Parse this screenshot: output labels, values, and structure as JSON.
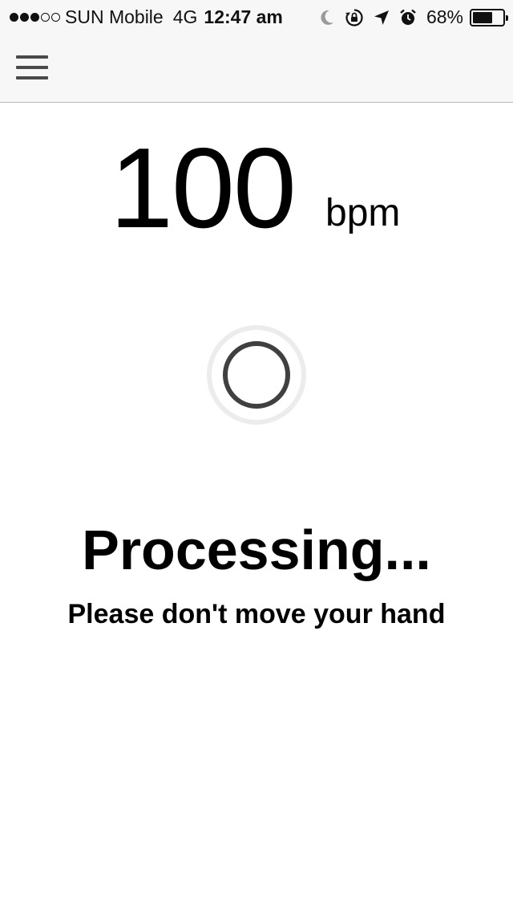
{
  "status_bar": {
    "signal_bars_filled": 3,
    "signal_bars_total": 5,
    "carrier": "SUN Mobile",
    "network": "4G",
    "time": "12:47 am",
    "icons": [
      "moon-icon",
      "rotation-lock-icon",
      "location-arrow-icon",
      "alarm-icon"
    ],
    "battery_percent_label": "68%",
    "battery_level": 0.68
  },
  "navbar": {
    "menu_icon": "hamburger-menu-icon"
  },
  "reading": {
    "value": "100",
    "unit": "bpm"
  },
  "spinner": {
    "icon": "loading-spinner-icon",
    "track_color": "#ececec",
    "ring_color": "#404040"
  },
  "status": {
    "title": "Processing...",
    "hint": "Please don't move your hand"
  }
}
